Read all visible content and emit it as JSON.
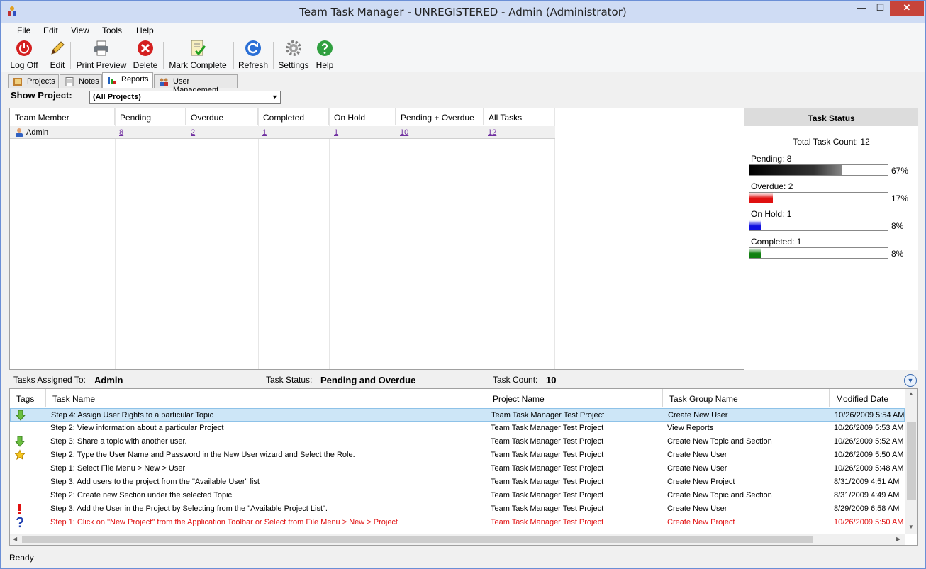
{
  "window": {
    "title": "Team Task Manager - UNREGISTERED - Admin (Administrator)",
    "min_glyph": "—",
    "max_glyph": "☐",
    "close_glyph": "✕"
  },
  "menu": [
    "File",
    "Edit",
    "View",
    "Tools",
    "Help"
  ],
  "toolbar": {
    "logoff": "Log Off",
    "edit": "Edit",
    "print_preview": "Print Preview",
    "delete": "Delete",
    "mark_complete": "Mark Complete",
    "refresh": "Refresh",
    "settings": "Settings",
    "help": "Help"
  },
  "tabs": [
    "Projects",
    "Notes",
    "Reports",
    "User Management"
  ],
  "filter": {
    "label": "Show Project:",
    "value": "(All Projects)",
    "arrow": "▼"
  },
  "summary": {
    "columns": [
      "Team Member",
      "Pending",
      "Overdue",
      "Completed",
      "On Hold",
      "Pending + Overdue",
      "All Tasks"
    ],
    "rows": [
      {
        "member": "Admin",
        "pending": "8",
        "overdue": "2",
        "completed": "1",
        "on_hold": "1",
        "pending_overdue": "10",
        "all_tasks": "12"
      }
    ]
  },
  "task_status": {
    "title": "Task Status",
    "total": "Total Task Count: 12",
    "bars": [
      {
        "label": "Pending: 8",
        "pct": "67%",
        "fraction": 0.67,
        "color": "#000000"
      },
      {
        "label": "Overdue: 2",
        "pct": "17%",
        "fraction": 0.17,
        "color": "#e01010"
      },
      {
        "label": "On Hold: 1",
        "pct": "8%",
        "fraction": 0.08,
        "color": "#1010e0"
      },
      {
        "label": "Completed: 1",
        "pct": "8%",
        "fraction": 0.08,
        "color": "#108010"
      }
    ]
  },
  "info": {
    "assigned_label": "Tasks Assigned To:",
    "assigned_value": "Admin",
    "status_label": "Task Status:",
    "status_value": "Pending and Overdue",
    "count_label": "Task Count:",
    "count_value": "10",
    "collapse_glyph": "▼"
  },
  "tasks": {
    "columns": [
      "Tags",
      "Task Name",
      "Project Name",
      "Task Group Name",
      "Modified Date"
    ],
    "rows": [
      {
        "tag": "arrow-down",
        "name": "Step 4: Assign User Rights to a particular Topic",
        "project": "Team Task Manager Test Project",
        "group": "Create New User",
        "date": "10/26/2009 5:54 AM",
        "red": false
      },
      {
        "tag": "",
        "name": "Step 2: View information about a particular Project",
        "project": "Team Task Manager Test Project",
        "group": "View Reports",
        "date": "10/26/2009 5:53 AM",
        "red": false
      },
      {
        "tag": "arrow-down",
        "name": "Step 3: Share a topic with another user.",
        "project": "Team Task Manager Test Project",
        "group": "Create New Topic and Section",
        "date": "10/26/2009 5:52 AM",
        "red": false
      },
      {
        "tag": "star",
        "name": "Step 2: Type the User Name and Password in the New User wizard and Select the Role.",
        "project": "Team Task Manager Test Project",
        "group": "Create New User",
        "date": "10/26/2009 5:50 AM",
        "red": false
      },
      {
        "tag": "",
        "name": "Step 1: Select File Menu > New > User",
        "project": "Team Task Manager Test Project",
        "group": "Create New User",
        "date": "10/26/2009 5:48 AM",
        "red": false
      },
      {
        "tag": "",
        "name": "Step 3: Add users to the project from the \"Available User\" list",
        "project": "Team Task Manager Test Project",
        "group": "Create New Project",
        "date": "8/31/2009 4:51 AM",
        "red": false
      },
      {
        "tag": "",
        "name": "Step 2: Create new Section under the selected Topic",
        "project": "Team Task Manager Test Project",
        "group": "Create New Topic and Section",
        "date": "8/31/2009 4:49 AM",
        "red": false
      },
      {
        "tag": "exclaim",
        "name": "Step 3: Add the User in the Project by Selecting from the \"Available Project List\".",
        "project": "Team Task Manager Test Project",
        "group": "Create New User",
        "date": "8/29/2009 6:58 AM",
        "red": false
      },
      {
        "tag": "question",
        "name": "Step 1: Click on \"New Project\" from the Application Toolbar or Select from File Menu > New > Project",
        "project": "Team Task Manager Test Project",
        "group": "Create New Project",
        "date": "10/26/2009 5:50 AM",
        "red": true
      }
    ]
  },
  "status": "Ready"
}
